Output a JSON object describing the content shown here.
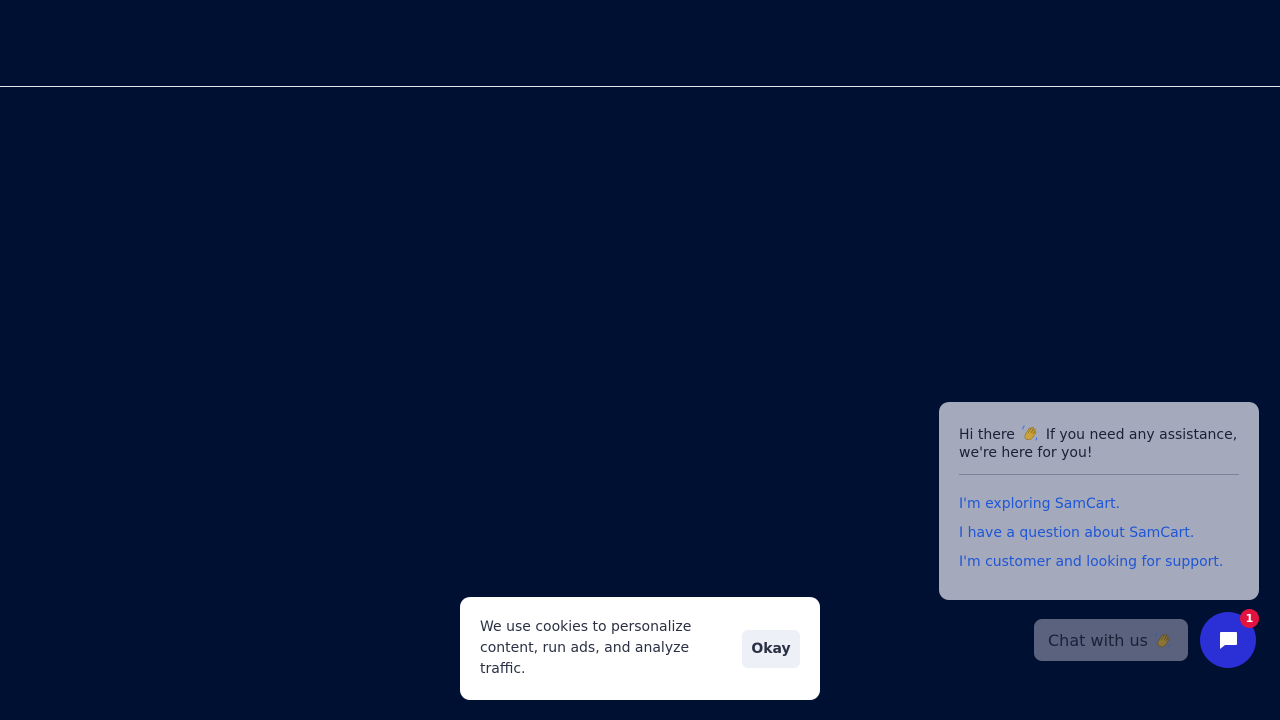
{
  "chat": {
    "greeting_before": "Hi there",
    "greeting_after": "If you need any assistance, we're here for you!",
    "options": [
      "I'm exploring SamCart.",
      "I have a question about SamCart.",
      "I'm customer and looking for support."
    ],
    "pill_label": "Chat with us",
    "badge_count": "1",
    "wave_icon": "waving-hand-icon",
    "launcher_icon": "chat-bubble-icon"
  },
  "cookie": {
    "message": "We use cookies to personalize content, run ads, and analyze traffic.",
    "okay_label": "Okay"
  },
  "colors": {
    "background": "#001033",
    "launcher": "#2a2fd6",
    "badge": "#e3133f",
    "link": "#1f56d6"
  }
}
